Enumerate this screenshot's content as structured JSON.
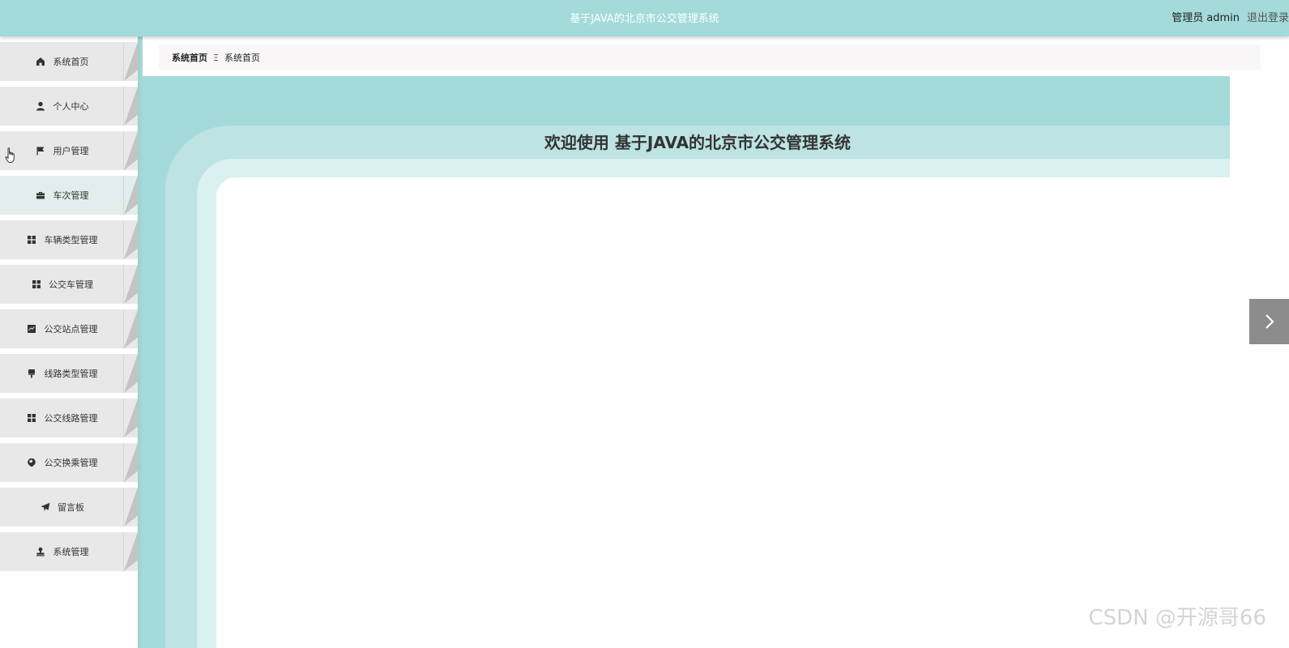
{
  "header": {
    "title": "基于JAVA的北京市公交管理系统",
    "user_role": "管理员",
    "user_name": "admin",
    "logout_label": "退出登录"
  },
  "sidebar": {
    "items": [
      {
        "label": "系统首页",
        "icon": "home-icon"
      },
      {
        "label": "个人中心",
        "icon": "user-icon"
      },
      {
        "label": "用户管理",
        "icon": "flag-icon"
      },
      {
        "label": "车次管理",
        "icon": "briefcase-icon"
      },
      {
        "label": "车辆类型管理",
        "icon": "grid-icon"
      },
      {
        "label": "公交车管理",
        "icon": "grid-icon"
      },
      {
        "label": "公交站点管理",
        "icon": "chart-icon"
      },
      {
        "label": "线路类型管理",
        "icon": "brush-icon"
      },
      {
        "label": "公交线路管理",
        "icon": "grid-icon"
      },
      {
        "label": "公交换乘管理",
        "icon": "globe-icon"
      },
      {
        "label": "留言板",
        "icon": "send-icon"
      },
      {
        "label": "系统管理",
        "icon": "stamp-icon"
      }
    ]
  },
  "breadcrumb": {
    "home": "系统首页",
    "separator": "Ξ",
    "current": "系统首页"
  },
  "main": {
    "welcome": "欢迎使用 基于JAVA的北京市公交管理系统"
  },
  "watermark": "CSDN @开源哥66",
  "colors": {
    "theme": "#a4dada",
    "menu_bg": "#e8e8e8",
    "fold": "#c4c4c4"
  }
}
